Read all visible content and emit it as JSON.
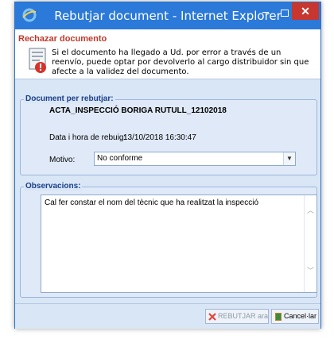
{
  "window": {
    "title": "Rebutjar document - Internet Explorer",
    "minimize_glyph": "−",
    "close_glyph": "✕"
  },
  "header": {
    "title": "Rechazar documento",
    "message": "Si el documento ha llegado a Ud. por error a través de un reenvío, puede optar por devolverlo al cargo distribuidor sin que afecte a la validez del documento.",
    "icon": "document-error-icon"
  },
  "document": {
    "legend": "Document per rebutjar:",
    "name": "ACTA_INSPECCIÓ BORIGA RUTULL_12102018",
    "received_label": "Data i hora de rebuig:",
    "received_value": "13/10/2018 16:30:47",
    "motivo_label": "Motivo:",
    "motivo_value": "No conforme"
  },
  "observations": {
    "legend": "Observacions:",
    "text": "Cal fer constar el nom del tècnic que ha realitzat la inspecció"
  },
  "footer": {
    "reject_label": "REBUTJAR ara",
    "cancel_label": "Cancel·lar"
  },
  "colors": {
    "titlebar": "#2b79d8",
    "close": "#c7372f",
    "accent_red": "#c0392b",
    "panel": "#d9e6f6",
    "legend": "#1a3f8a"
  }
}
